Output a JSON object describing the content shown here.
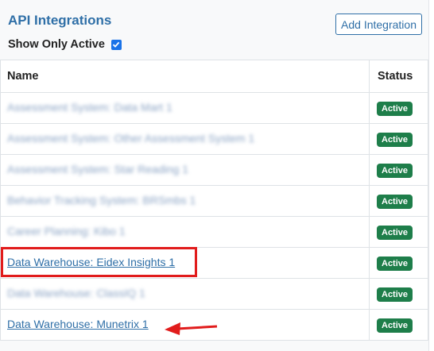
{
  "header": {
    "title": "API Integrations",
    "add_button_label": "Add Integration",
    "show_active_label": "Show Only Active",
    "show_active_checked": true
  },
  "table": {
    "columns": [
      "Name",
      "Status"
    ],
    "rows": [
      {
        "name": "Assessment System: Data Mart 1",
        "status": "Active",
        "blurred": true
      },
      {
        "name": "Assessment System: Other Assessment System 1",
        "status": "Active",
        "blurred": true
      },
      {
        "name": "Assessment System: Star Reading 1",
        "status": "Active",
        "blurred": true
      },
      {
        "name": "Behavior Tracking System: BRSmbs 1",
        "status": "Active",
        "blurred": true
      },
      {
        "name": "Career Planning: Kibo 1",
        "status": "Active",
        "blurred": true
      },
      {
        "name": "Data Warehouse: Eidex Insights 1",
        "status": "Active",
        "blurred": false
      },
      {
        "name": "Data Warehouse: ClassIQ 1",
        "status": "Active",
        "blurred": true
      },
      {
        "name": "Data Warehouse: Munetrix 1",
        "status": "Active",
        "blurred": false
      }
    ]
  },
  "colors": {
    "title": "#2f6fa7",
    "badge": "#1e7e4a",
    "annotation": "#e11c1c"
  }
}
